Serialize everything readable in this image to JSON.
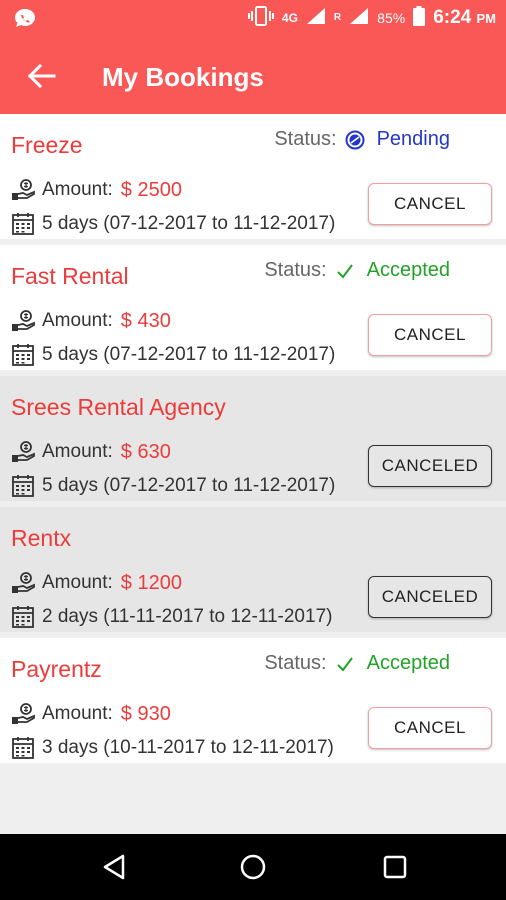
{
  "status_bar": {
    "network": "4G",
    "roaming": "R",
    "battery": "85%",
    "time": "6:24",
    "ampm": "PM"
  },
  "app_bar": {
    "title": "My Bookings"
  },
  "bookings": [
    {
      "name": "Freeze",
      "status_label": "Status:",
      "status": "Pending",
      "amount_label": "Amount:",
      "amount": "$ 2500",
      "dates": "5 days (07-12-2017 to 11-12-2017)",
      "button": "CANCEL"
    },
    {
      "name": "Fast Rental",
      "status_label": "Status:",
      "status": "Accepted",
      "amount_label": "Amount:",
      "amount": "$ 430",
      "dates": "5 days (07-12-2017 to 11-12-2017)",
      "button": "CANCEL"
    },
    {
      "name": "Srees Rental Agency",
      "amount_label": "Amount:",
      "amount": "$ 630",
      "dates": "5 days (07-12-2017 to 11-12-2017)",
      "button": "CANCELED"
    },
    {
      "name": "Rentx",
      "amount_label": "Amount:",
      "amount": "$ 1200",
      "dates": "2 days (11-11-2017 to 12-11-2017)",
      "button": "CANCELED"
    },
    {
      "name": "Payrentz",
      "status_label": "Status:",
      "status": "Accepted",
      "amount_label": "Amount:",
      "amount": "$ 930",
      "dates": "3 days (10-11-2017 to 12-11-2017)",
      "button": "CANCEL"
    }
  ],
  "colors": {
    "primary": "#f95857",
    "name_red": "#ec3b3b",
    "pending_blue": "#2437c9",
    "accepted_green": "#22a227"
  },
  "icons": [
    "whatsapp-icon",
    "vibrate-icon",
    "signal-icon",
    "battery-icon",
    "back-arrow-icon",
    "pending-icon",
    "check-icon",
    "money-hand-icon",
    "calendar-icon",
    "nav-back-icon",
    "nav-home-icon",
    "nav-recents-icon"
  ]
}
